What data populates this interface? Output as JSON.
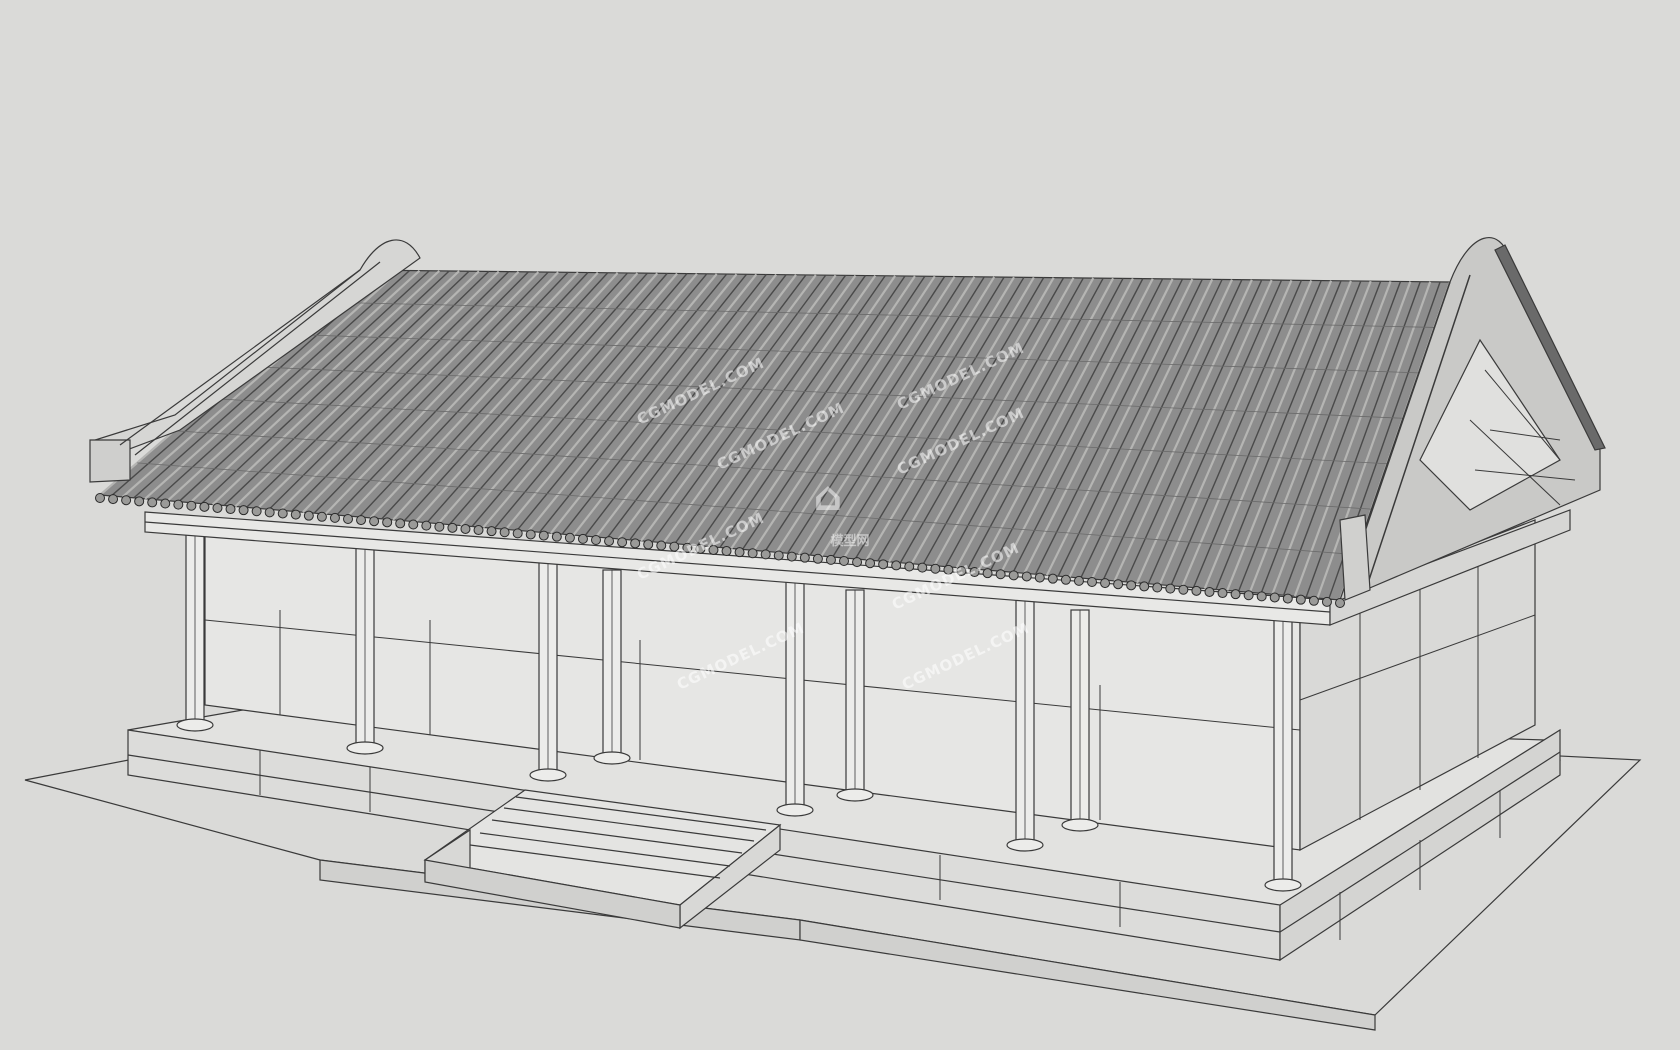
{
  "viewport": {
    "background_color": "#dadad8",
    "line_color": "#3a3a3a",
    "roof_tile_color": "#5a5a5a",
    "subject": "wireframe-chinese-hall-model"
  },
  "watermark": {
    "brand_text": "CGMODEL.COM",
    "logo_glyph": "⌂",
    "logo_label": "模型网",
    "color": "#ffffff"
  }
}
